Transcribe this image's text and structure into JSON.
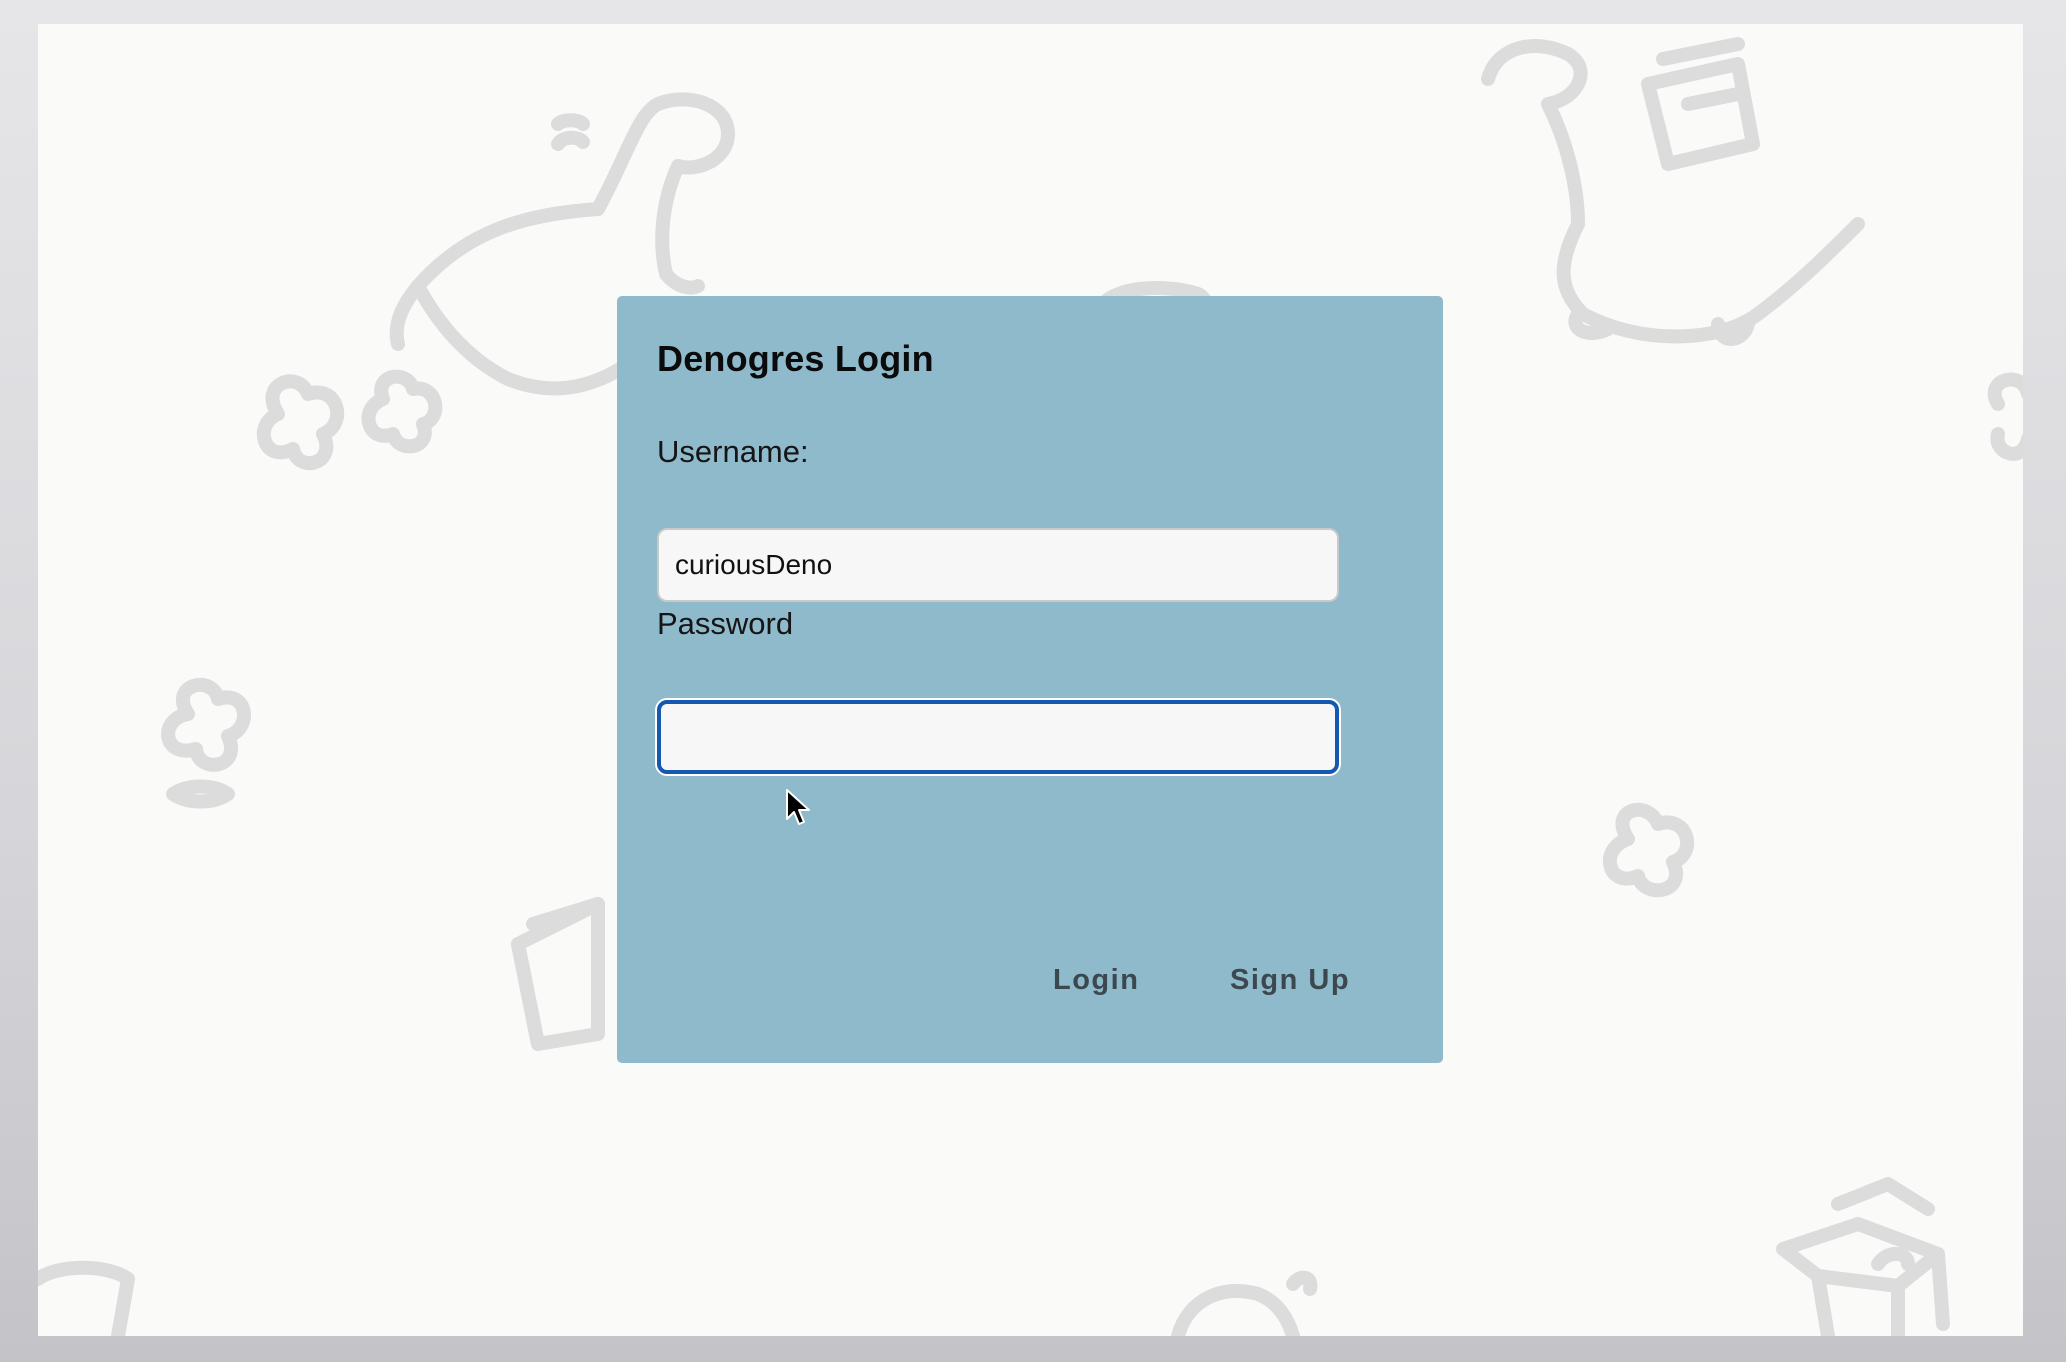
{
  "login": {
    "title": "Denogres Login",
    "username_label": "Username:",
    "username_value": "curiousDeno",
    "password_label": "Password",
    "password_value": "",
    "login_button": "Login",
    "signup_button": "Sign Up"
  },
  "colors": {
    "card_background": "#8fbacc",
    "focus_ring": "#1558b0",
    "button_text": "#3c4850",
    "page_background": "#fafaf9",
    "doodle_stroke": "#dcdcdc"
  },
  "icons": {
    "background_pattern": "dinosaur-doodle-pattern",
    "cursor": "mouse-pointer-icon"
  }
}
